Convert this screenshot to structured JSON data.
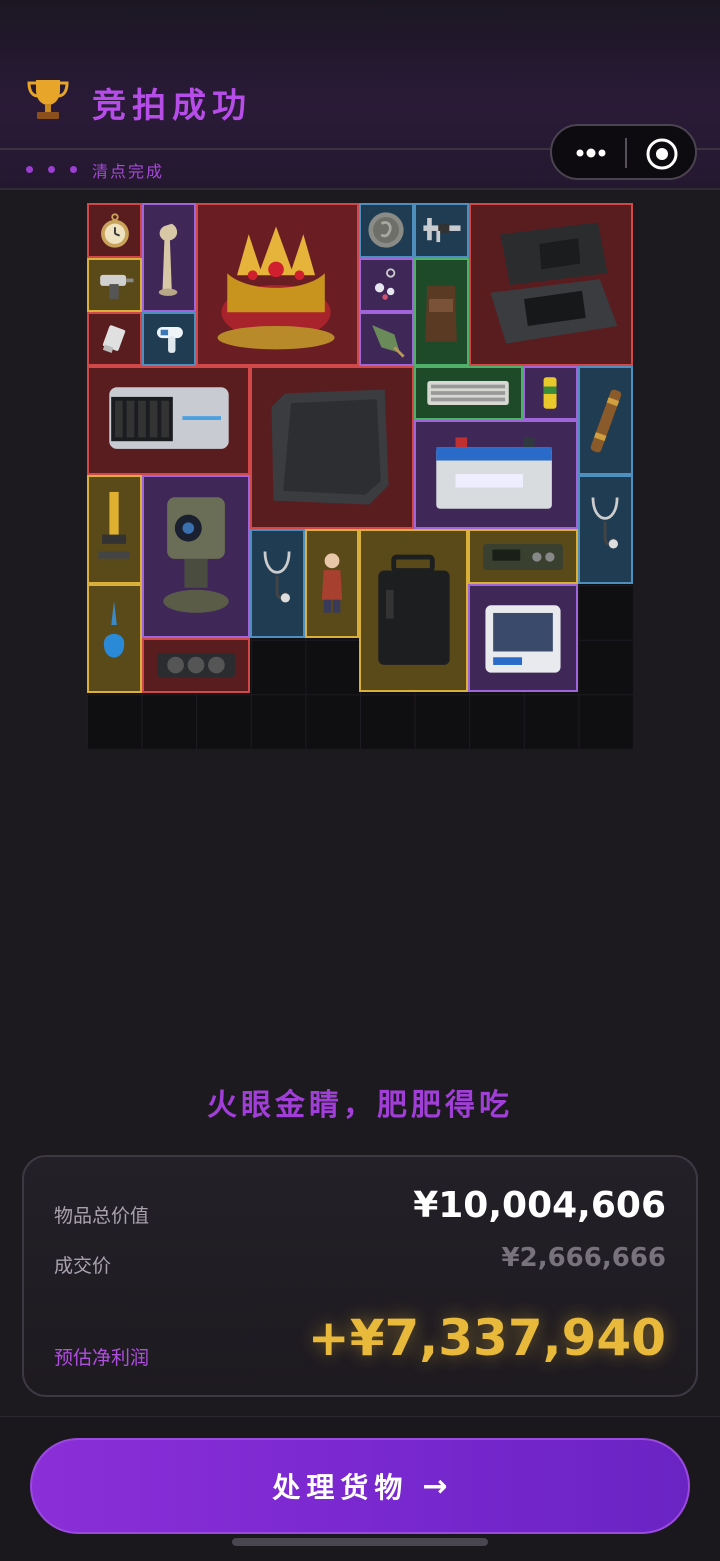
{
  "header": {
    "title": "竞拍成功",
    "trophy_icon": "trophy-icon",
    "status_label": "清点完成"
  },
  "capsule": {
    "more_icon": "more-dots-icon",
    "close_icon": "target-close-icon"
  },
  "items": [
    {
      "name": "pocket-watch",
      "rarity": "red"
    },
    {
      "name": "carved-figurine",
      "rarity": "purple"
    },
    {
      "name": "jeweled-crown-in-box",
      "rarity": "red"
    },
    {
      "name": "ancient-coin",
      "rarity": "blue"
    },
    {
      "name": "caliper",
      "rarity": "blue"
    },
    {
      "name": "rugged-laptop-case",
      "rarity": "red"
    },
    {
      "name": "power-drill",
      "rarity": "gold"
    },
    {
      "name": "earring",
      "rarity": "purple"
    },
    {
      "name": "coffee-bag",
      "rarity": "green"
    },
    {
      "name": "usb-drive",
      "rarity": "red"
    },
    {
      "name": "thermometer-gun",
      "rarity": "blue"
    },
    {
      "name": "arrowhead",
      "rarity": "purple"
    },
    {
      "name": "server-drive-bay",
      "rarity": "red"
    },
    {
      "name": "carbon-plate",
      "rarity": "red"
    },
    {
      "name": "keyboard",
      "rarity": "green"
    },
    {
      "name": "soda-can",
      "rarity": "purple"
    },
    {
      "name": "spyglass",
      "rarity": "blue"
    },
    {
      "name": "car-battery",
      "rarity": "purple"
    },
    {
      "name": "stethoscope",
      "rarity": "blue"
    },
    {
      "name": "gold-microscope",
      "rarity": "gold"
    },
    {
      "name": "security-camera-turret",
      "rarity": "purple"
    },
    {
      "name": "stethoscope",
      "rarity": "blue"
    },
    {
      "name": "porcelain-figurine",
      "rarity": "gold"
    },
    {
      "name": "power-station-case",
      "rarity": "gold"
    },
    {
      "name": "military-radio",
      "rarity": "gold"
    },
    {
      "name": "perfume-bottle",
      "rarity": "gold"
    },
    {
      "name": "graphics-card",
      "rarity": "red"
    },
    {
      "name": "lab-shaker",
      "rarity": "purple"
    }
  ],
  "slogan": "火眼金睛，肥肥得吃",
  "summary": {
    "total_label": "物品总价值",
    "total_value": "¥10,004,606",
    "deal_label": "成交价",
    "deal_value": "¥2,666,666",
    "profit_label": "预估净利润",
    "profit_value": "+¥7,337,940"
  },
  "action": {
    "label": "处理货物",
    "arrow": "→"
  },
  "colors": {
    "accent": "#a23ed8",
    "profit": "#e8b93a",
    "red": "#d04848",
    "purple": "#a065d8",
    "blue": "#4f8fc0",
    "gold": "#d8b03a",
    "green": "#4fb06a"
  }
}
